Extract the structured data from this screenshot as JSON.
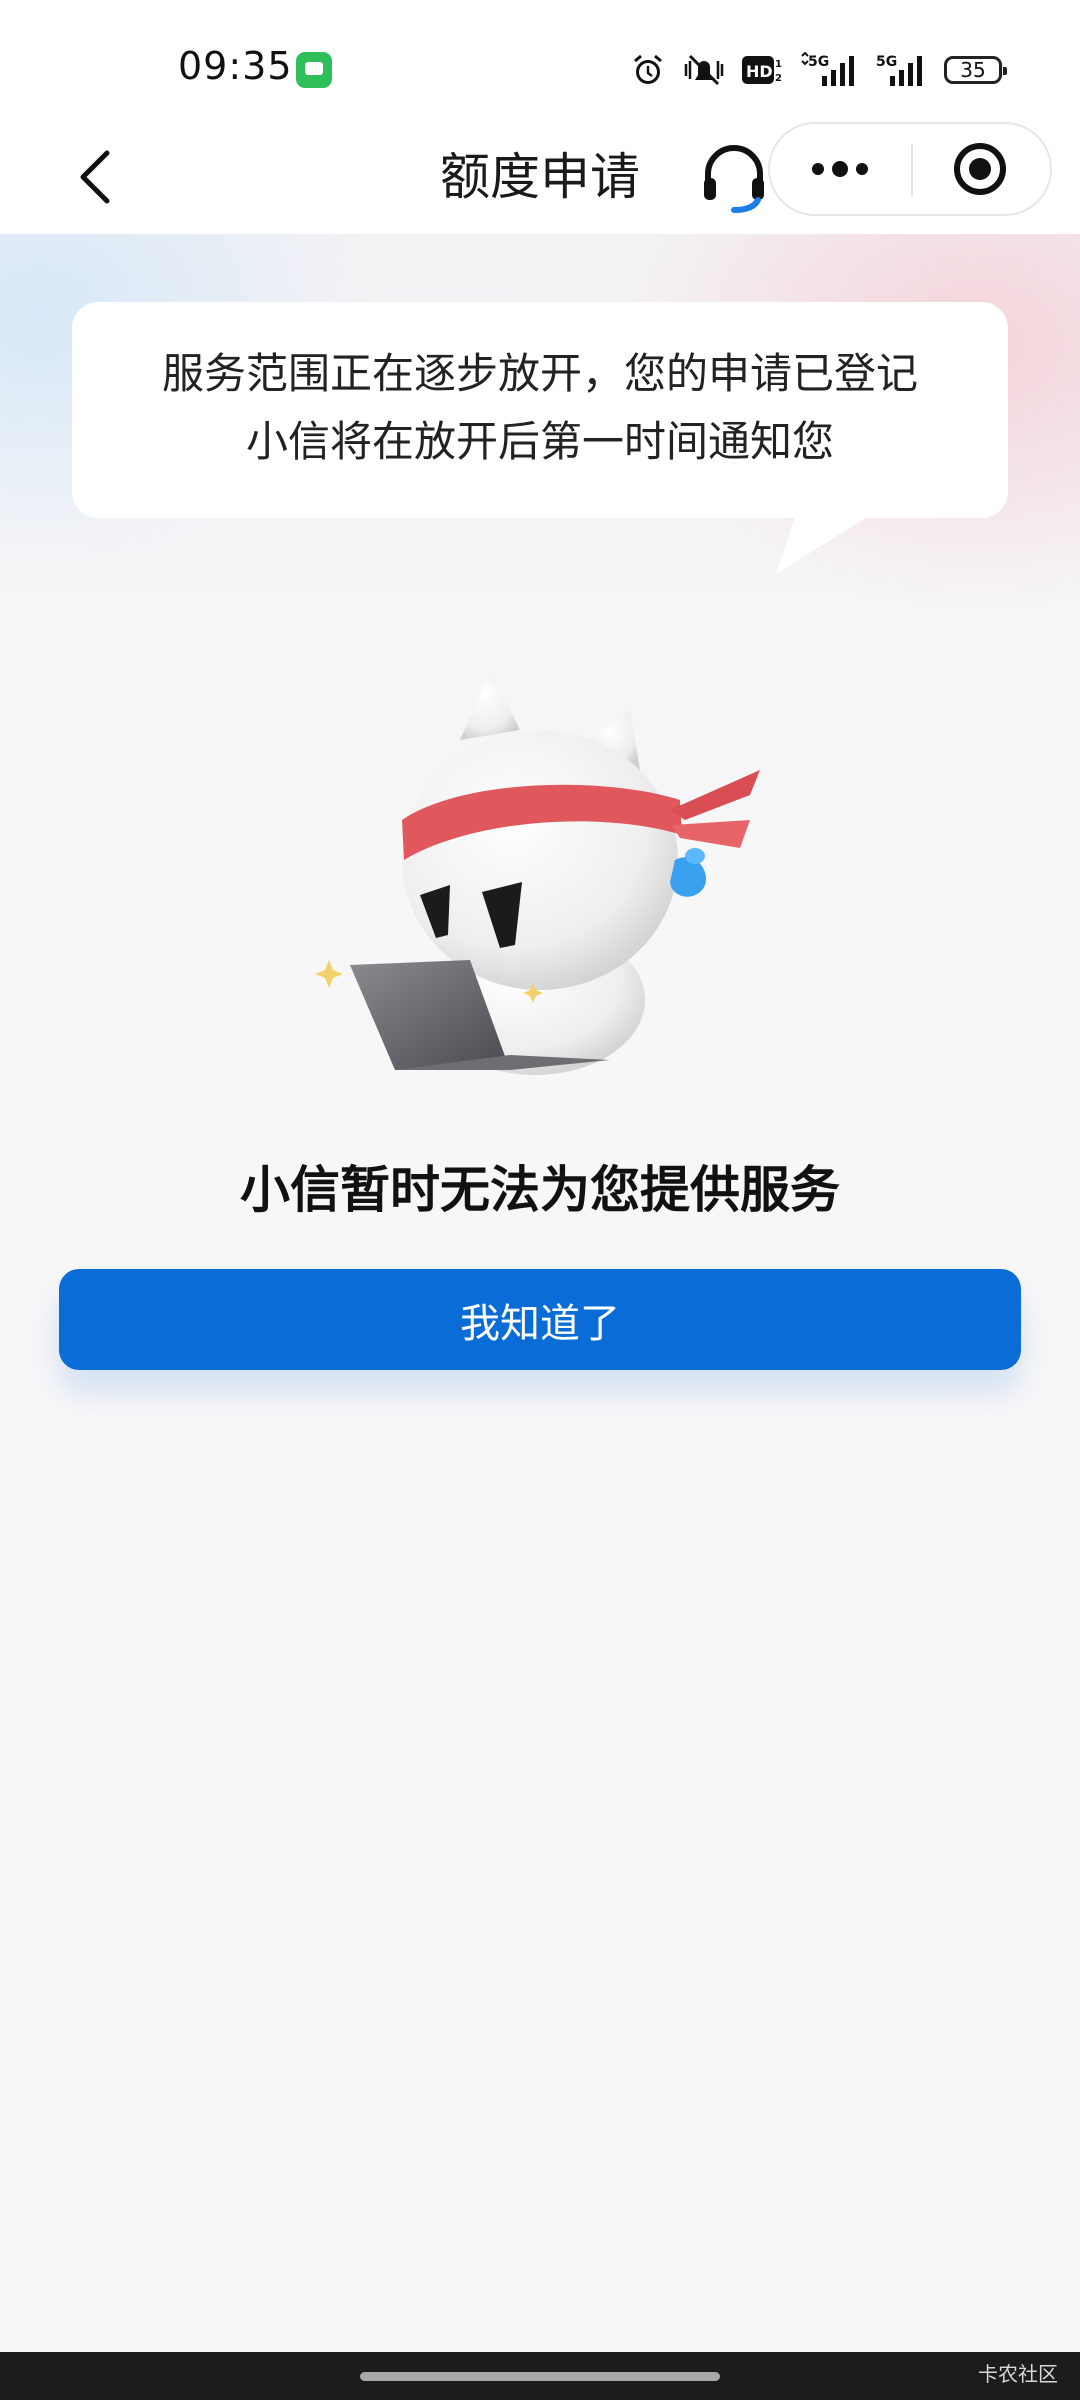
{
  "status_bar": {
    "time": "09:35",
    "battery": "35",
    "network_labels": [
      "HD",
      "5G",
      "5G"
    ]
  },
  "nav": {
    "title": "额度申请"
  },
  "bubble": {
    "line1": "服务范围正在逐步放开，您的申请已登记",
    "line2": "小信将在放开后第一时间通知您"
  },
  "main": {
    "notice_title": "小信暂时无法为您提供服务",
    "ok_button_label": "我知道了"
  },
  "footer": {
    "watermark": "卡农社区"
  },
  "colors": {
    "primary_button": "#0a6cd6",
    "headband": "#e0585b",
    "sweat": "#3aa0f0",
    "message_app": "#2ebf5b"
  }
}
